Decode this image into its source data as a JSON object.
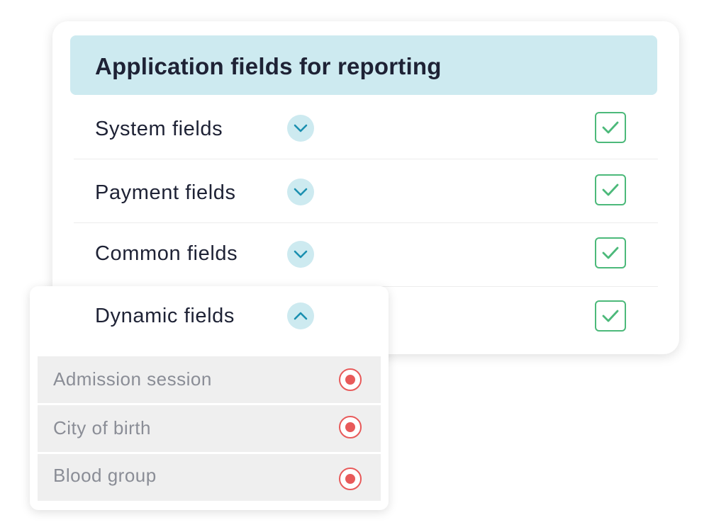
{
  "panel": {
    "title": "Application fields for reporting"
  },
  "field_groups": [
    {
      "label": "System fields",
      "expanded": false,
      "checked": true
    },
    {
      "label": "Payment fields",
      "expanded": false,
      "checked": true
    },
    {
      "label": "Common fields",
      "expanded": false,
      "checked": true
    },
    {
      "label": "Dynamic fields",
      "expanded": true,
      "checked": true
    }
  ],
  "dynamic_fields": {
    "label": "Dynamic fields",
    "items": [
      {
        "label": "Admission session",
        "selected": true
      },
      {
        "label": "City of birth",
        "selected": true
      },
      {
        "label": "Blood group",
        "selected": true
      }
    ]
  },
  "colors": {
    "header_bg": "#cdeaf0",
    "chevron_stroke": "#1b8fb0",
    "checkbox_green": "#4cb97a",
    "radio_red": "#e85a5a",
    "sub_item_bg": "#efefef"
  },
  "icons": {
    "collapsed": "chevron-down-icon",
    "expanded": "chevron-up-icon",
    "checked": "checkbox-checked-icon",
    "selected": "radio-selected-icon"
  }
}
